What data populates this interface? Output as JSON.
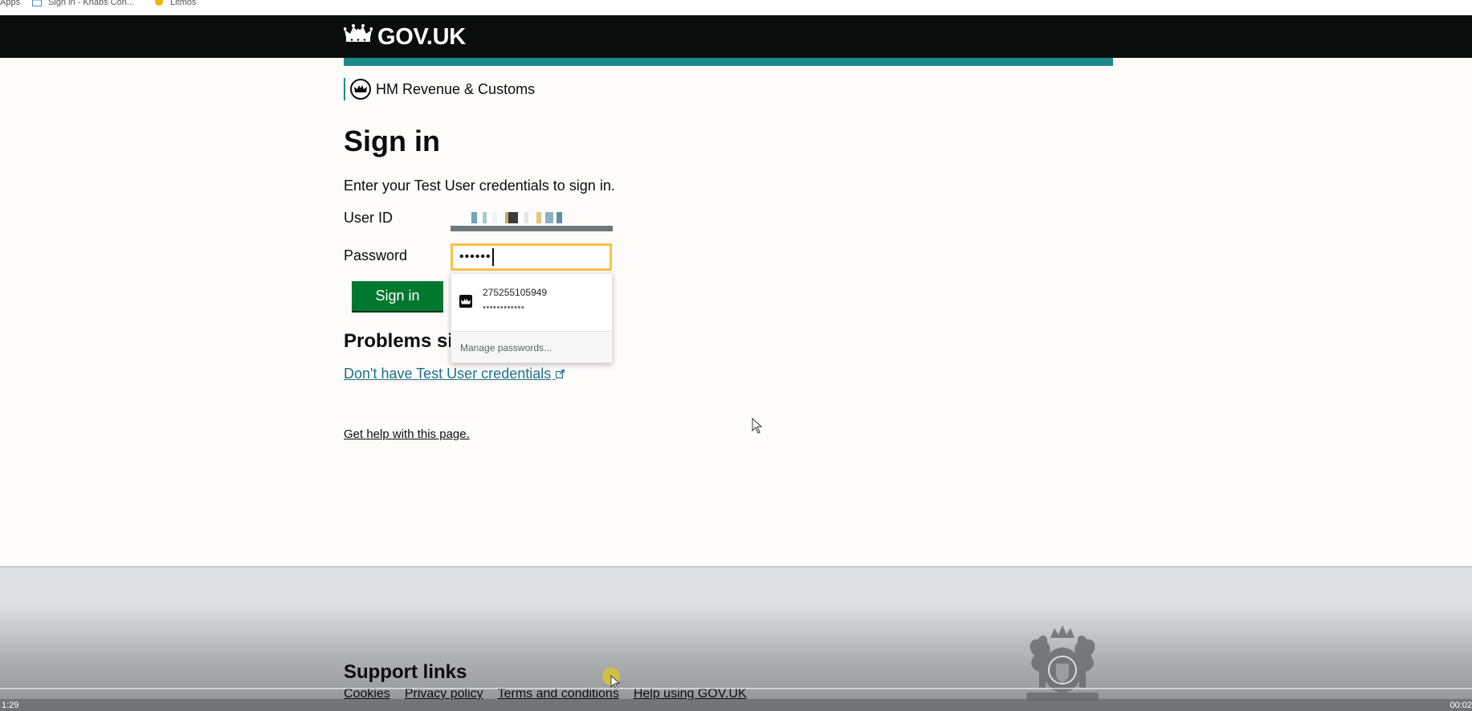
{
  "bookmarks": [
    {
      "label": "Apps",
      "icon": "apps-grid-icon"
    },
    {
      "label": "Sign in - Knabs Con...",
      "icon": "page-icon"
    },
    {
      "label": "Litmos",
      "icon": "litmos-icon"
    }
  ],
  "header": {
    "logo_text": "GOV.UK",
    "department": "HM Revenue & Customs"
  },
  "page": {
    "title": "Sign in",
    "intro": "Enter your Test User credentials to sign in.",
    "user_id_label": "User ID",
    "password_label": "Password",
    "password_value": "••••••",
    "sign_in_button": "Sign in",
    "problems_heading": "Problems sig",
    "credentials_link": "Don't have Test User credentials",
    "help_link": "Get help with this page."
  },
  "autofill": {
    "saved_user": "275255105949",
    "saved_password_mask": "••••••••••••",
    "manage_label": "Manage passwords..."
  },
  "footer": {
    "heading": "Support links",
    "links": [
      "Cookies",
      "Privacy policy",
      "Terms and conditions",
      "Help using GOV.UK"
    ]
  },
  "video": {
    "time_elapsed": "1:29",
    "time_right": "00:02"
  },
  "colors": {
    "header_bg": "#0b0c0c",
    "teal_accent": "#1d8a8a",
    "button_green": "#00782f",
    "focus_yellow": "#ffbf47"
  }
}
